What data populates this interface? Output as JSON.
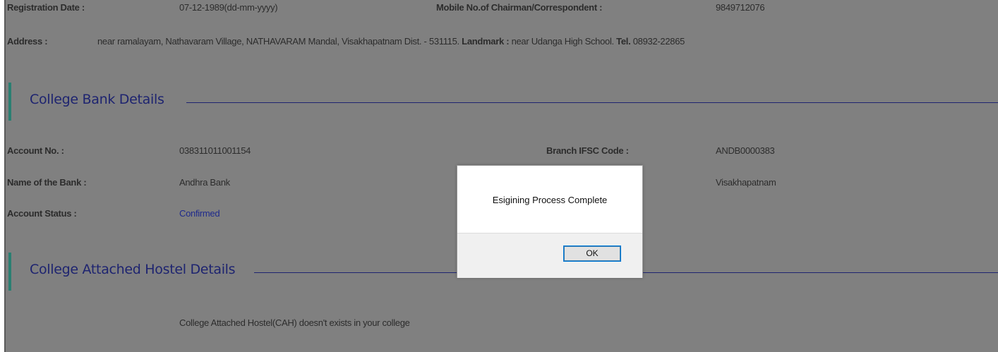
{
  "registration": {
    "date_label": "Registration Date :",
    "date_value": "07-12-1989(dd-mm-yyyy)",
    "mobile_label": "Mobile No.of Chairman/Correspondent :",
    "mobile_value": "9849712076"
  },
  "address": {
    "label": "Address :",
    "text": "near ramalayam, Nathavaram Village, NATHAVARAM Mandal, Visakhapatnam Dist. - 531115.",
    "landmark_label": "Landmark :",
    "landmark_value": "near Udanga High School.",
    "tel_label": "Tel.",
    "tel_value": "08932-22865"
  },
  "bank_section": {
    "title": "College Bank Details",
    "account_no_label": "Account No. :",
    "account_no_value": "038311011001154",
    "ifsc_label": "Branch IFSC Code :",
    "ifsc_value": "ANDB0000383",
    "bank_name_label": "Name of the Bank :",
    "bank_name_value": "Andhra Bank",
    "branch_value": "Visakhapatnam",
    "status_label": "Account Status :",
    "status_value": "Confirmed"
  },
  "hostel_section": {
    "title": "College Attached Hostel Details",
    "message": "College Attached Hostel(CAH) doesn't exists in your college"
  },
  "dialog": {
    "message": "Esigining Process Complete",
    "ok_label": "OK"
  }
}
